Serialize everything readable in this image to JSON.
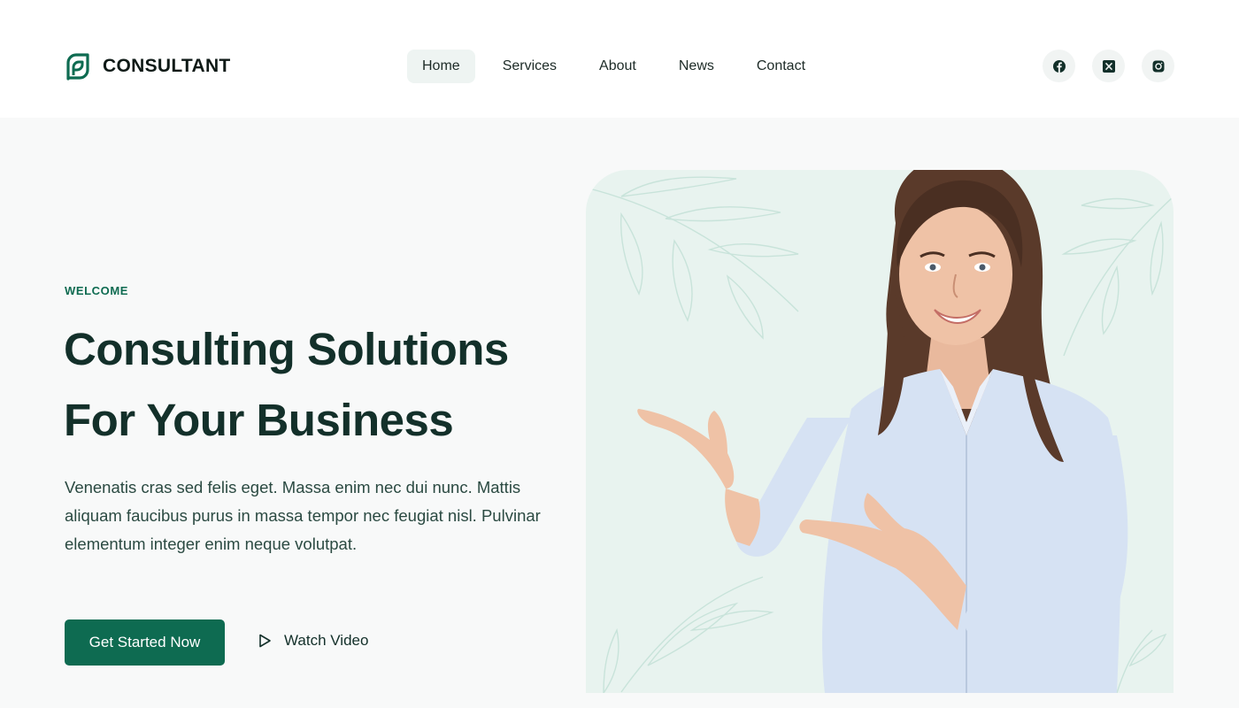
{
  "brand": {
    "name": "CONSULTANT",
    "logo_icon": "leaf-logo-icon",
    "color": "#0e6b51"
  },
  "nav": {
    "items": [
      {
        "label": "Home",
        "active": true
      },
      {
        "label": "Services",
        "active": false
      },
      {
        "label": "About",
        "active": false
      },
      {
        "label": "News",
        "active": false
      },
      {
        "label": "Contact",
        "active": false
      }
    ]
  },
  "socials": [
    {
      "icon": "facebook-icon"
    },
    {
      "icon": "x-twitter-icon"
    },
    {
      "icon": "instagram-icon"
    }
  ],
  "hero": {
    "eyebrow": "WELCOME",
    "title_line1": "Consulting Solutions",
    "title_line2": "For Your Business",
    "description": "Venenatis cras sed felis eget. Massa enim nec dui nunc. Mattis aliquam faucibus purus in massa tempor nec feugiat nisl. Pulvinar elementum integer enim neque volutpat.",
    "primary_button": "Get Started Now",
    "secondary_button": "Watch Video",
    "secondary_icon": "play-icon"
  },
  "colors": {
    "accent": "#0e6b51",
    "heading": "#13302a",
    "hero_bg": "#f8f9f9",
    "media_bg": "#e8f3ef"
  }
}
